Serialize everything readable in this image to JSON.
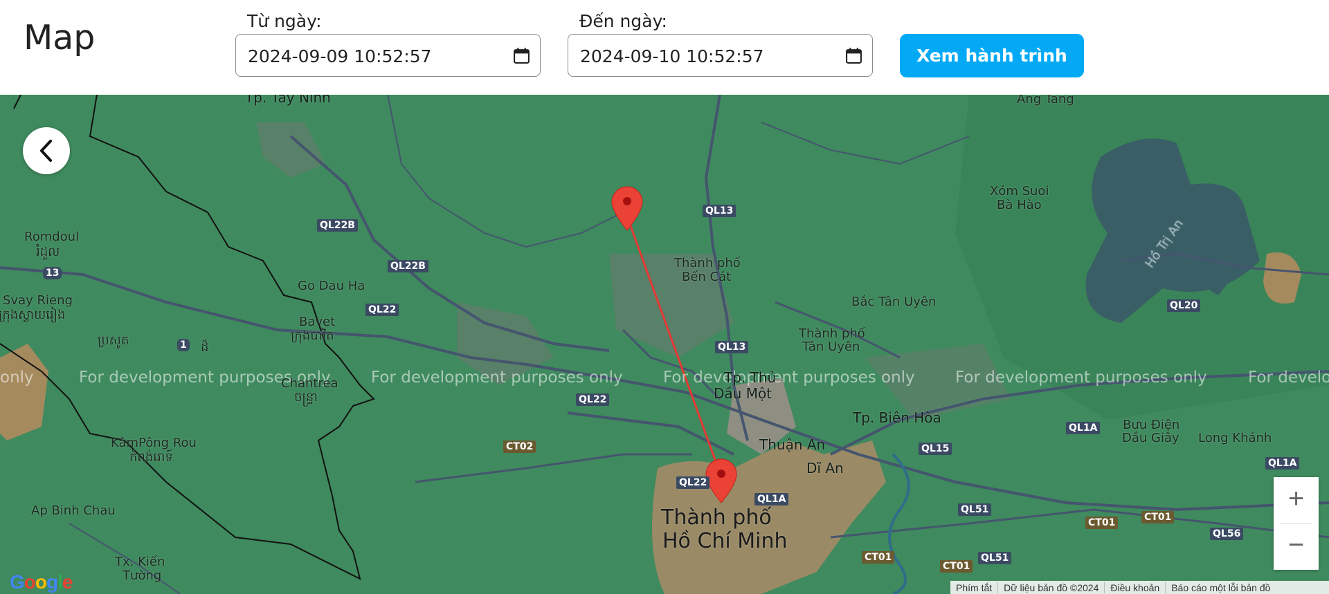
{
  "header": {
    "title": "Map",
    "from_label": "Từ ngày:",
    "from_value": "2024-09-09 10:52:57",
    "to_label": "Đến ngày:",
    "to_value": "2024-09-10 10:52:57",
    "view_button": "Xem hành trình"
  },
  "map": {
    "watermark": "For development purposes only",
    "watermark_fragment_left": "only",
    "watermark_fragment_right": "For develo",
    "labels": {
      "tay_ninh": "Tp. Tây Ninh",
      "ang_tang": "Ang Tang",
      "xom_suoi_1": "Xóm Suoi",
      "xom_suoi_2": "Bà Hào",
      "ho_tri_an": "Hồ Trị An",
      "romdoul_1": "Romdoul",
      "romdoul_2": "រំដួល",
      "svay_rieng_1": "Svay Rieng",
      "svay_rieng_2": "ក្រុងស្វាយរៀង",
      "go_dau_ha": "Go Dau Ha",
      "bavet_1": "Bavet",
      "bavet_2": "ក្រុងបាវិត",
      "prasout": "ប្រសូត",
      "chantrea_1": "Chantrea",
      "chantrea_2": "ចន្ទ្រា",
      "kampong_rou_1": "KâmPông Rou",
      "kampong_rou_2": "កំពង់រោទ៍",
      "ap_binh_chau": "Ap Binh Chau",
      "kien_tuong_1": "Tx. Kiến",
      "kien_tuong_2": "Tường",
      "ben_cat_1": "Thành phố",
      "ben_cat_2": "Bến Cát",
      "bac_tan_uyen": "Bắc Tân Uyên",
      "tan_uyen_1": "Thành phố",
      "tan_uyen_2": "Tân Uyên",
      "thu_dau_mot_1": "Tp. Thủ",
      "thu_dau_mot_2": "Dầu Một",
      "bien_hoa": "Tp. Biên Hòa",
      "thuan_an": "Thuận An",
      "di_an": "Dĩ An",
      "buu_dien_1": "Bưu Điện",
      "buu_dien_2": "Dầu Giây",
      "long_khanh": "Long Khánh",
      "hcm_1": "Thành phố",
      "hcm_2": "Hồ Chí Minh"
    },
    "roads": [
      "QL22B",
      "QL22B",
      "QL22",
      "QL22",
      "QL22",
      "QL13",
      "QL13",
      "QL1A",
      "QL1A",
      "QL1A",
      "QL15",
      "QL51",
      "QL51",
      "QL20",
      "QL56",
      "CT02",
      "CT01",
      "CT01",
      "CT01",
      "CT01",
      "13",
      "1",
      "ដ៏"
    ],
    "zoom_in": "+",
    "zoom_out": "−",
    "google": [
      "G",
      "o",
      "o",
      "g",
      "l",
      "e"
    ],
    "google_colors": [
      "#4285f4",
      "#ea4335",
      "#fbbc05",
      "#4285f4",
      "#34a853",
      "#ea4335"
    ],
    "attribution": {
      "shortcuts": "Phím tắt",
      "data": "Dữ liệu bản đồ ©2024",
      "terms": "Điều khoản",
      "report": "Báo cáo một lỗi bản đồ"
    },
    "route_color": "#e53935",
    "marker_color": "#ea4335"
  },
  "icons": {
    "calendar": "calendar-icon",
    "back": "chevron-left-icon"
  }
}
